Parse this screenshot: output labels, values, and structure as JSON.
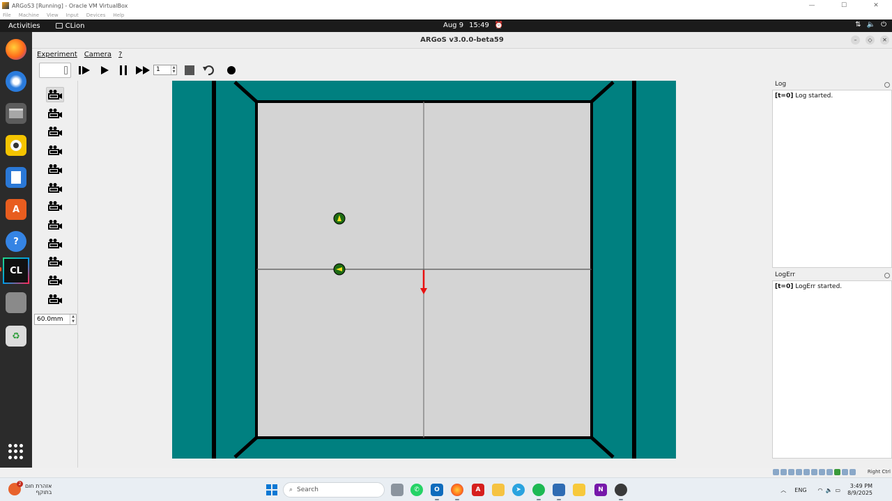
{
  "vbox": {
    "title": "ARGoS3 [Running] - Oracle VM VirtualBox",
    "menu": [
      "File",
      "Machine",
      "View",
      "Input",
      "Devices",
      "Help"
    ],
    "statusbar": {
      "host_key": "Right Ctrl"
    }
  },
  "gnome": {
    "activities": "Activities",
    "focused_app": "CLion",
    "date": "Aug 9",
    "time": "15:49",
    "tray_icons": [
      "network-icon",
      "volume-icon",
      "power-icon"
    ]
  },
  "dock": {
    "apps": [
      "firefox",
      "thunderbird",
      "files",
      "rhythmbox",
      "libreoffice-writer",
      "ubuntu-software",
      "help",
      "clion",
      "blank-app",
      "trash"
    ],
    "clion_label": "CL"
  },
  "argos": {
    "title": "ARGoS v3.0.0-beta59",
    "menu": {
      "experiment": "Experiment",
      "camera": "Camera",
      "help": "?"
    },
    "toolbar": {
      "frames_value": "1",
      "buttons": [
        "step",
        "play",
        "pause",
        "fast-forward",
        "stop",
        "reset",
        "record"
      ]
    },
    "camera": {
      "count": 12,
      "selected_index": 0,
      "zoom_value": "60.0mm"
    },
    "log": {
      "title": "Log",
      "entries": [
        {
          "tag": "[t=0]",
          "text": "Log started."
        }
      ]
    },
    "logerr": {
      "title": "LogErr",
      "entries": [
        {
          "tag": "[t=0]",
          "text": "LogErr started."
        }
      ]
    },
    "colors": {
      "background": "#008080",
      "floor": "#d4d4d4",
      "wall": "#000000",
      "robot": "#1e6b14",
      "robot_marker": "#f0e020",
      "axis_arrow": "#e81010"
    }
  },
  "taskbar": {
    "weather_line1": "אזהרת חום",
    "weather_line2": "בתוקף",
    "weather_badge": "2",
    "search_placeholder": "Search",
    "apps": [
      "task-view",
      "whatsapp",
      "outlook",
      "firefox",
      "acrobat",
      "file-explorer",
      "telegram",
      "spotify",
      "virtualbox",
      "python",
      "onenote",
      "app"
    ],
    "language": "ENG",
    "time": "3:49 PM",
    "date": "8/9/2025"
  }
}
